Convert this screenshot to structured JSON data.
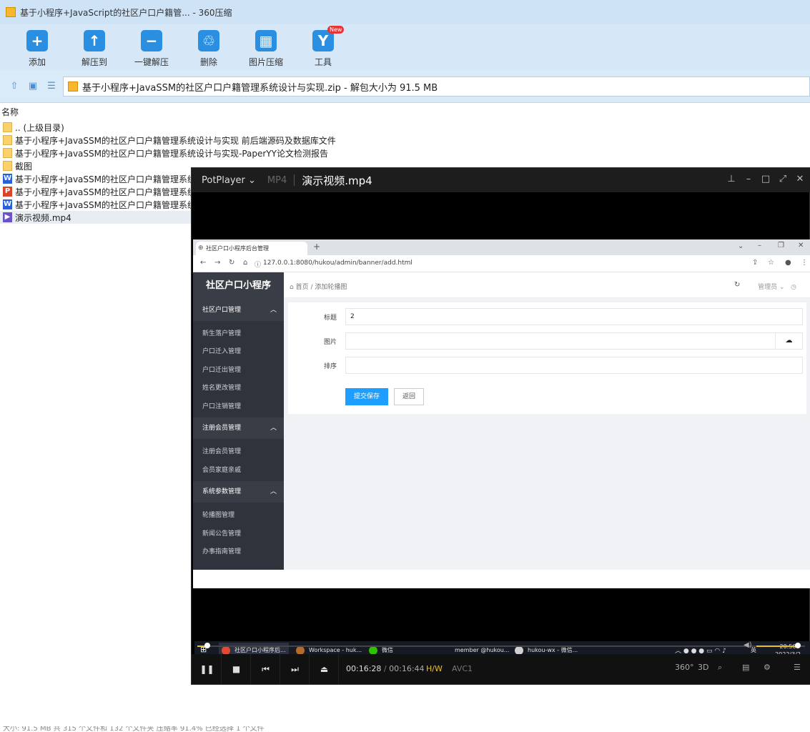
{
  "zip": {
    "title": "基于小程序+JavaScript的社区户口户籍管... - 360压缩",
    "toolbar": [
      {
        "label": "添加",
        "icon": "add-archive-icon",
        "glyph": "+"
      },
      {
        "label": "解压到",
        "icon": "extract-to-icon",
        "glyph": "↑"
      },
      {
        "label": "一键解压",
        "icon": "quick-extract-icon",
        "glyph": "−"
      },
      {
        "label": "删除",
        "icon": "delete-icon",
        "glyph": "♲"
      },
      {
        "label": "图片压缩",
        "icon": "image-compress-icon",
        "glyph": "▦"
      },
      {
        "label": "工具",
        "icon": "tools-icon",
        "glyph": "Y",
        "badge": "New"
      }
    ],
    "path": "基于小程序+JavaSSM的社区户口户籍管理系统设计与实现.zip - 解包大小为 91.5 MB",
    "column_name": "名称",
    "files": [
      {
        "name": ".. (上级目录)",
        "type": "folder"
      },
      {
        "name": "基于小程序+JavaSSM的社区户口户籍管理系统设计与实现 前后端源码及数据库文件",
        "type": "folder"
      },
      {
        "name": "基于小程序+JavaSSM的社区户口户籍管理系统设计与实现-PaperYY论文检测报告",
        "type": "folder"
      },
      {
        "name": "截图",
        "type": "folder"
      },
      {
        "name": "基于小程序+JavaSSM的社区户口户籍管理系统",
        "type": "word"
      },
      {
        "name": "基于小程序+JavaSSM的社区户口户籍管理系统",
        "type": "ppt"
      },
      {
        "name": "基于小程序+JavaSSM的社区户口户籍管理系统",
        "type": "word"
      },
      {
        "name": "演示视频.mp4",
        "type": "mp4"
      }
    ],
    "status": "大小: 91.5 MB 共 315 个文件和 132 个文件夹 压缩率 91.4% 已经选择 1 个文件"
  },
  "player": {
    "brand": "PotPlayer",
    "format": "MP4",
    "file": "演示视频.mp4",
    "time_current": "00:16:28",
    "time_sep": "/",
    "time_total": "00:16:44",
    "hw": "H/W",
    "codec": "AVC1",
    "seek_fraction": 0.016,
    "volume_fraction": 0.95,
    "right_buttons": [
      "360°",
      "3D"
    ]
  },
  "browser": {
    "tab_title": "社区户口小程序后台管理",
    "url": "127.0.0.1:8080/hukou/admin/banner/add.html"
  },
  "admin": {
    "logo": "社区户口小程序",
    "breadcrumb_home": "首页",
    "breadcrumb_sep": "/",
    "breadcrumb_current": "添加轮播图",
    "user": "管理员",
    "groups": [
      {
        "title": "社区户口管理",
        "items": [
          "新生落户管理",
          "户口迁入管理",
          "户口迁出管理",
          "姓名更改管理",
          "户口注销管理"
        ]
      },
      {
        "title": "注册会员管理",
        "items": [
          "注册会员管理",
          "会员家庭亲戚"
        ]
      },
      {
        "title": "系统参数管理",
        "items": [
          "轮播图管理",
          "新闻公告管理",
          "办事指南管理"
        ]
      }
    ],
    "form": {
      "title_label": "标题",
      "title_value": "2",
      "image_label": "图片",
      "sort_label": "排序",
      "save": "提交保存",
      "back": "返回"
    }
  },
  "taskbar": {
    "apps": [
      "社区户口小程序后...",
      "Workspace - huk...",
      "微信",
      "member @hukou...",
      "hukou-wx - 微信..."
    ],
    "ime": "英",
    "time": "20:50",
    "date": "2022/3/2"
  }
}
